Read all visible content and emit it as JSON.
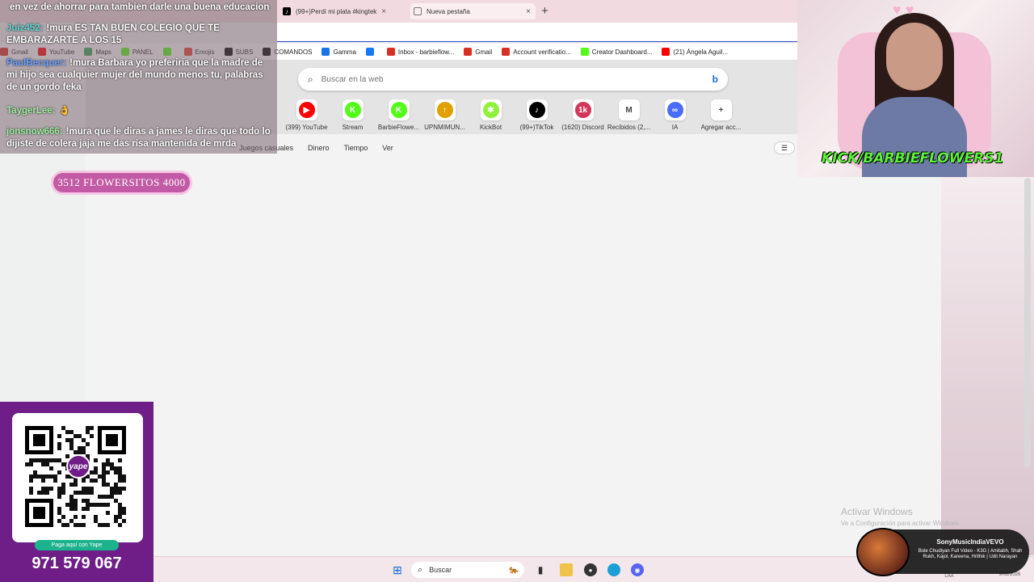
{
  "browser": {
    "tabs": [
      {
        "label": "(99+)Perdí mi plata #kingtek",
        "active": false
      },
      {
        "label": "Nueva pestaña",
        "active": true
      }
    ],
    "bookmarks": [
      {
        "label": "Gmail",
        "icon": "gmail-icon",
        "color": "#d93025"
      },
      {
        "label": "YouTube",
        "icon": "youtube-icon",
        "color": "#ff0000"
      },
      {
        "label": "Maps",
        "icon": "maps-icon",
        "color": "#34a853"
      },
      {
        "label": "PANEL",
        "icon": "kick-icon",
        "color": "#53fc18"
      },
      {
        "label": "",
        "icon": "kick-icon",
        "color": "#53fc18"
      },
      {
        "label": "Emojis",
        "icon": "emoji-icon",
        "color": "#e6442f"
      },
      {
        "label": "SUBS",
        "icon": "tiktok-icon",
        "color": "#000000"
      },
      {
        "label": "COMANDOS",
        "icon": "tiktok-icon",
        "color": "#000000"
      },
      {
        "label": "Gamma",
        "icon": "gamma-icon",
        "color": "#1a73e8"
      },
      {
        "label": "",
        "icon": "facebook-icon",
        "color": "#1877f2"
      },
      {
        "label": "Inbox - barbieflow...",
        "icon": "gmail-icon",
        "color": "#d93025"
      },
      {
        "label": "Gmail",
        "icon": "gmail-icon",
        "color": "#d93025"
      },
      {
        "label": "Account verificatio...",
        "icon": "gmail-icon",
        "color": "#d93025"
      },
      {
        "label": "Creator Dashboard...",
        "icon": "kick-icon",
        "color": "#53fc18"
      },
      {
        "label": "(21) Ángela Aguil...",
        "icon": "youtube-icon",
        "color": "#ff0000"
      }
    ]
  },
  "newtab": {
    "search_placeholder": "Buscar en la web",
    "quicklinks": [
      {
        "label": "(399) YouTube",
        "icon": "youtube-icon",
        "color": "#ff0000",
        "glyph": "▶"
      },
      {
        "label": "Stream",
        "icon": "kick-icon",
        "color": "#53fc18",
        "glyph": "K"
      },
      {
        "label": "BarbieFlowe...",
        "icon": "kick-icon",
        "color": "#53fc18",
        "glyph": "K"
      },
      {
        "label": "UPNMIMUN...",
        "icon": "upn-icon",
        "color": "#e0a100",
        "glyph": "↑"
      },
      {
        "label": "KickBot",
        "icon": "kickbot-icon",
        "color": "#8ef23a",
        "glyph": "✱"
      },
      {
        "label": "(99+)TikTok",
        "icon": "tiktok-icon",
        "color": "#000000",
        "glyph": "♪"
      },
      {
        "label": "(1620) Discord",
        "icon": "discord-icon",
        "color": "#d1365a",
        "glyph": "1k"
      },
      {
        "label": "Recibidos (2,...",
        "icon": "gmail-icon",
        "color": "#ffffff",
        "glyph": "M"
      },
      {
        "label": "IA",
        "icon": "ai-icon",
        "color": "#4a6cf7",
        "glyph": "∞"
      },
      {
        "label": "Agregar acc...",
        "icon": "plus-icon",
        "color": "#ffffff",
        "glyph": "+"
      }
    ],
    "feed_nav": [
      "Juegos casuales",
      "Dinero",
      "Tiempo",
      "Ver"
    ]
  },
  "windows_notice": {
    "title": "Activar Windows",
    "subtitle": "Ve a Configuración para activar Windows."
  },
  "chat": {
    "messages": [
      {
        "user": "",
        "user_color": "#ffffff",
        "text": "en vez de ahorrar para tambien darle una buena educacion"
      },
      {
        "user": "Juiz452:",
        "user_color": "#5fd6d6",
        "text": "!mura ES TAN BUEN COLEGIO QUE TE EMBARAZARTE A LOS 15"
      },
      {
        "user": "PaulBecquer:",
        "user_color": "#6aa0ff",
        "text": "!mura Barbara yo preferiria que la madre de mi hijo sea cualquier mujer del mundo menos tu, palabras de un gordo feka"
      },
      {
        "user": "TaygerLee:",
        "user_color": "#9ef0a0",
        "text": "👌"
      },
      {
        "user": "jonsnow666:",
        "user_color": "#9ef0a0",
        "text": "!mura que le diras a james le diras que todo lo dijiste de colera jaja me das risa mantenida de mrda"
      }
    ],
    "goal": "3512 FLOWERSITOS 4000"
  },
  "yape": {
    "badge": "yape",
    "cta": "Paga aquí con Yape",
    "phone": "971 579 067"
  },
  "webcam": {
    "handle": "KICK/BARBIEFLOWERS1"
  },
  "taskbar": {
    "search_label": "Buscar",
    "lang": "LAA",
    "date": "9/02/2026"
  },
  "now_playing": {
    "channel": "SonyMusicIndiaVEVO",
    "title": "Bole Chudiyan Full Video - K3G | Amitabh, Shah Rukh, Kajol, Kareena, Hrithik | Udit Narayan"
  }
}
